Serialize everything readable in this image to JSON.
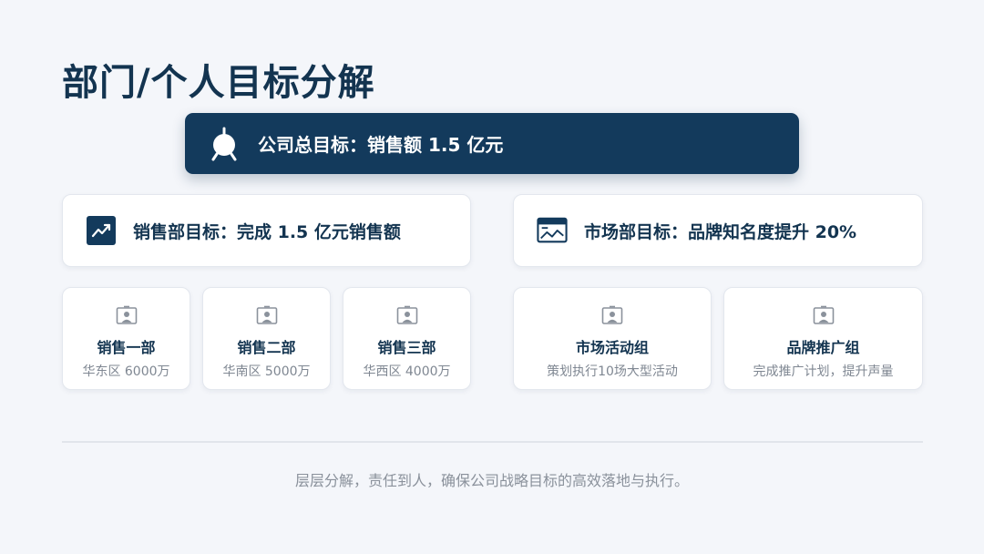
{
  "page": {
    "title": "部门/个人目标分解",
    "company_goal": "公司总目标：销售额 1.5 亿元",
    "footer_note": "层层分解，责任到人，确保公司战略目标的高效落地与执行。"
  },
  "departments": [
    {
      "goal": "销售部目标：完成 1.5 亿元销售额",
      "icon": "trend-up-icon"
    },
    {
      "goal": "市场部目标：品牌知名度提升 20%",
      "icon": "browser-chart-icon"
    }
  ],
  "teams": [
    {
      "name": "销售一部",
      "desc": "华东区 6000万",
      "icon": "person-icon"
    },
    {
      "name": "销售二部",
      "desc": "华南区 5000万",
      "icon": "person-icon"
    },
    {
      "name": "销售三部",
      "desc": "华西区 4000万",
      "icon": "person-icon"
    },
    {
      "name": "市场活动组",
      "desc": "策划执行10场大型活动",
      "icon": "person-icon"
    },
    {
      "name": "品牌推广组",
      "desc": "完成推广计划，提升声量",
      "icon": "person-icon"
    }
  ],
  "colors": {
    "primary": "#133a5c",
    "text": "#133450",
    "muted": "#7f8792",
    "background": "#f4f6fa"
  }
}
